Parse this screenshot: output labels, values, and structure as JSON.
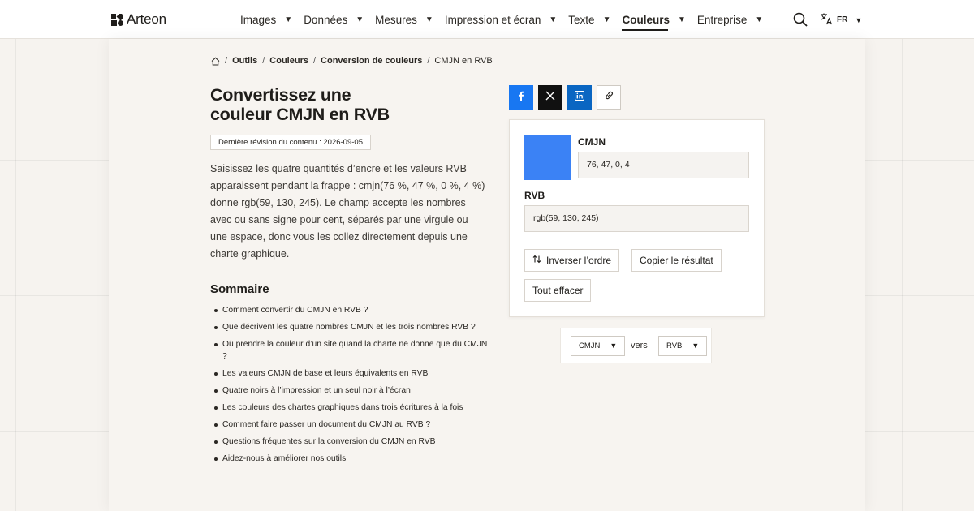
{
  "brand": {
    "name": "Arteon"
  },
  "nav": {
    "items": [
      {
        "label": "Images",
        "active": false
      },
      {
        "label": "Données",
        "active": false
      },
      {
        "label": "Mesures",
        "active": false
      },
      {
        "label": "Impression et écran",
        "active": false
      },
      {
        "label": "Texte",
        "active": false
      },
      {
        "label": "Couleurs",
        "active": true
      },
      {
        "label": "Entreprise",
        "active": false
      }
    ],
    "caret": "▼",
    "language": "FR"
  },
  "breadcrumb": {
    "items": [
      "Outils",
      "Couleurs",
      "Conversion de couleurs"
    ],
    "current": "CMJN en RVB",
    "separator": "/"
  },
  "page": {
    "title_line1": "Convertissez une",
    "title_line2": "couleur CMJN en RVB",
    "revision": "Dernière révision du contenu : 2026-09-05",
    "intro": "Saisissez les quatre quantités d’encre et les valeurs RVB apparaissent pendant la frappe : cmjn(76 %, 47 %, 0 %, 4 %) donne rgb(59, 130, 245). Le champ accepte les nombres avec ou sans signe pour cent, séparés par une virgule ou une espace, donc vous les collez directement depuis une charte graphique."
  },
  "toc": {
    "title": "Sommaire",
    "items": [
      "Comment convertir du CMJN en RVB ?",
      "Que décrivent les quatre nombres CMJN et les trois nombres RVB ?",
      "Où prendre la couleur d’un site quand la charte ne donne que du CMJN ?",
      "Les valeurs CMJN de base et leurs équivalents en RVB",
      "Quatre noirs à l’impression et un seul noir à l’écran",
      "Les couleurs des chartes graphiques dans trois écritures à la fois",
      "Comment faire passer un document du CMJN au RVB ?",
      "Questions fréquentes sur la conversion du CMJN en RVB",
      "Aidez-nous à améliorer nos outils"
    ]
  },
  "converter": {
    "swatch_color": "#3b82f5",
    "cmjn_label": "CMJN",
    "cmjn_value": "76, 47, 0, 4",
    "rvb_label": "RVB",
    "rvb_value": "rgb(59, 130, 245)",
    "swap_label": "Inverser l’ordre",
    "copy_label": "Copier le résultat",
    "clear_label": "Tout effacer"
  },
  "units": {
    "from": "CMJN",
    "to": "RVB",
    "joiner": "vers"
  },
  "colors": {
    "facebook": "#1877f2",
    "x": "#111111",
    "linkedin": "#0a66c2"
  }
}
